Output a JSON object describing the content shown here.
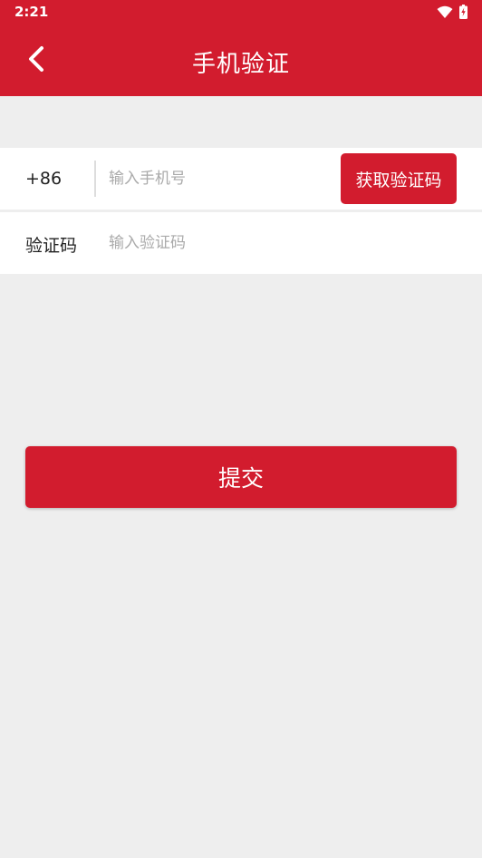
{
  "status_bar": {
    "time": "2:21",
    "icons": [
      "wifi-icon",
      "battery-charging-icon"
    ]
  },
  "header": {
    "title": "手机验证",
    "back_icon": "chevron-left-icon",
    "background": "#d21c2e"
  },
  "phone_row": {
    "prefix": "+86",
    "placeholder": "输入手机号",
    "value": "",
    "get_code_label": "获取验证码"
  },
  "code_row": {
    "label": "验证码",
    "placeholder": "输入验证码",
    "value": ""
  },
  "submit": {
    "label": "提交"
  },
  "colors": {
    "accent": "#d21c2e",
    "page_background": "#eeeeee"
  }
}
